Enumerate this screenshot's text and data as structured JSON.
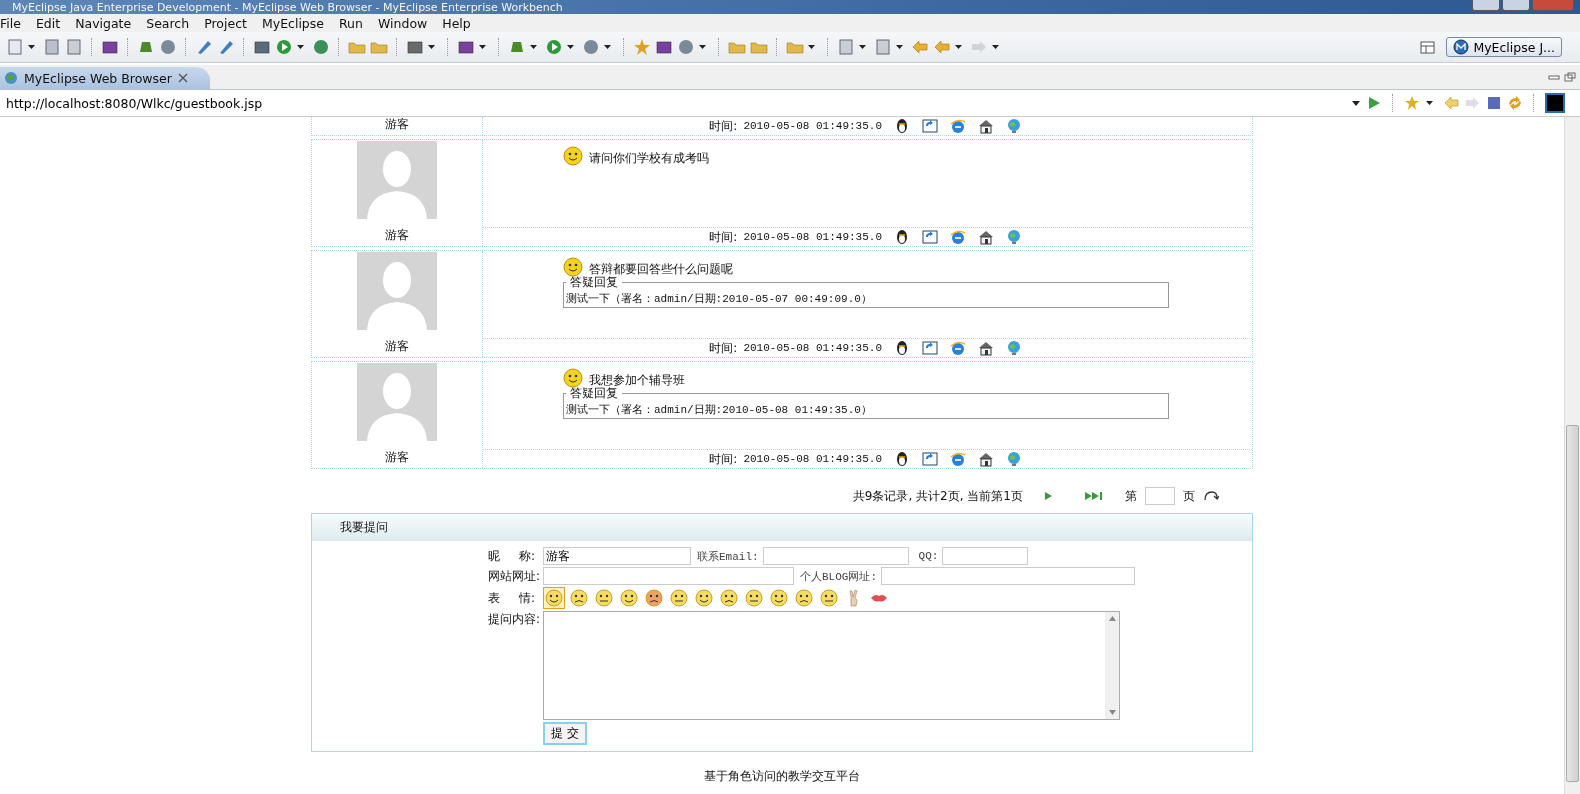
{
  "window": {
    "title": "MyEclipse Java Enterprise Development - MyEclipse Web Browser - MyEclipse Enterprise Workbench"
  },
  "menu": [
    "File",
    "Edit",
    "Navigate",
    "Search",
    "Project",
    "MyEclipse",
    "Run",
    "Window",
    "Help"
  ],
  "perspective": {
    "label": "MyEclipse J..."
  },
  "editor_tab": {
    "title": "MyEclipse Web Browser",
    "selected": true
  },
  "address_bar": {
    "value": "http://localhost:8080/Wlkc/guestbook.jsp"
  },
  "posts": [
    {
      "kind": "partial",
      "author": "游客",
      "time_label": "时间:",
      "time": "2010-05-08 01:49:35.0"
    },
    {
      "kind": "full",
      "author": "游客",
      "message": "请问你们学校有成考吗",
      "time_label": "时间:",
      "time": "2010-05-08 01:49:35.0"
    },
    {
      "kind": "full",
      "author": "游客",
      "message": "答辩都要回答些什么问题呢",
      "reply": {
        "legend": "答疑回复",
        "text": "测试一下（署名：admin/日期:2010-05-07 00:49:09.0）"
      },
      "time_label": "时间:",
      "time": "2010-05-08 01:49:35.0"
    },
    {
      "kind": "full",
      "author": "游客",
      "message": "我想参加个辅导班",
      "reply": {
        "legend": "答疑回复",
        "text": "测试一下（署名：admin/日期:2010-05-08 01:49:35.0）"
      },
      "time_label": "时间:",
      "time": "2010-05-08 01:49:35.0"
    }
  ],
  "pagination": {
    "summary": "共9条记录, 共计2页, 当前第1页",
    "page_prefix": "第",
    "page_suffix": "页"
  },
  "form": {
    "title": "我要提问",
    "nickname_label": "昵     称:",
    "nickname_value": "游客",
    "email_label": "联系Email:",
    "qq_label": "QQ:",
    "website_label": "网站网址:",
    "blog_label": "个人BLOG网址:",
    "emoticon_label": "表     情:",
    "content_label": "提问内容:",
    "submit": "提 交"
  },
  "emoticons": [
    {
      "selected": true
    },
    {
      "selected": false
    },
    {
      "selected": false
    },
    {
      "selected": false
    },
    {
      "selected": false
    },
    {
      "selected": false
    },
    {
      "selected": false
    },
    {
      "selected": false
    },
    {
      "selected": false
    },
    {
      "selected": false
    },
    {
      "selected": false
    },
    {
      "selected": false
    },
    {
      "selected": false
    },
    {
      "selected": false
    }
  ],
  "footer": "基于角色访问的教学交互平台"
}
